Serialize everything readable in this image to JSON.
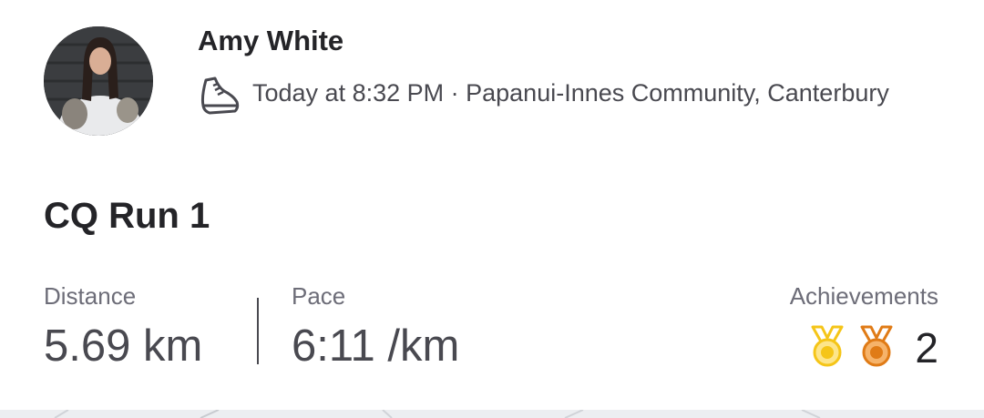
{
  "activity": {
    "athlete_name": "Amy White",
    "sport_icon": "running-shoe-icon",
    "time_location": "Today at 8:32 PM · Papanui-Innes Community, Canterbury",
    "title": "CQ Run 1"
  },
  "stats": {
    "distance_label": "Distance",
    "distance_value": "5.69 km",
    "pace_label": "Pace",
    "pace_value": "6:11 /km",
    "achievements_label": "Achievements",
    "achievements_count": "2",
    "medals": [
      {
        "icon": "gold-medal-icon",
        "color": "#f5c518"
      },
      {
        "icon": "bronze-medal-icon",
        "color": "#e07b16"
      }
    ]
  }
}
